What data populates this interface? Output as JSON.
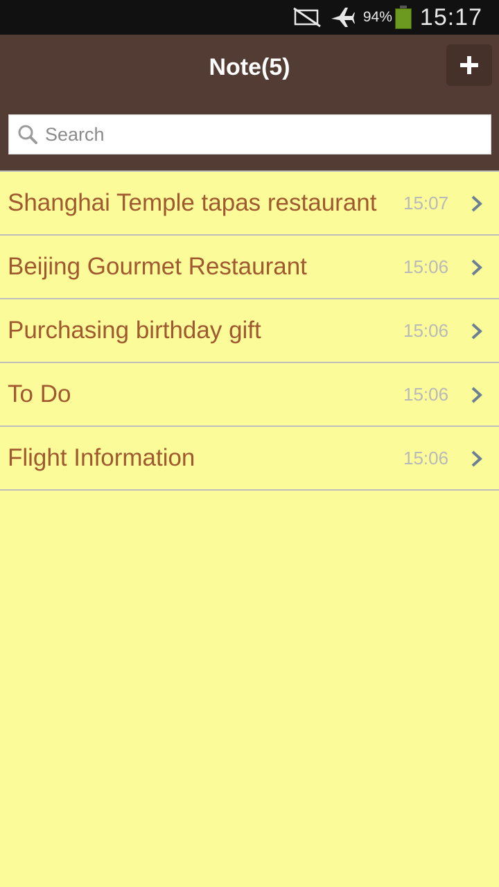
{
  "status_bar": {
    "battery_percent": "94%",
    "time": "15:17",
    "icons": [
      "no-sim-icon",
      "airplane-mode-icon",
      "battery-icon"
    ]
  },
  "header": {
    "title": "Note(5)",
    "add_icon": "plus-icon"
  },
  "search": {
    "placeholder": "Search",
    "icon": "search-icon"
  },
  "notes": [
    {
      "title": "Shanghai Temple tapas restaurant",
      "time": "15:07"
    },
    {
      "title": "Beijing Gourmet Restaurant",
      "time": "15:06"
    },
    {
      "title": "Purchasing birthday gift",
      "time": "15:06"
    },
    {
      "title": "To Do",
      "time": "15:06"
    },
    {
      "title": "Flight Information",
      "time": "15:06"
    }
  ],
  "colors": {
    "header_bg": "#533c33",
    "list_bg": "#fbfb99",
    "note_title": "#a0592f",
    "note_time": "#b9b9b9",
    "divider": "#bdbdbd"
  }
}
